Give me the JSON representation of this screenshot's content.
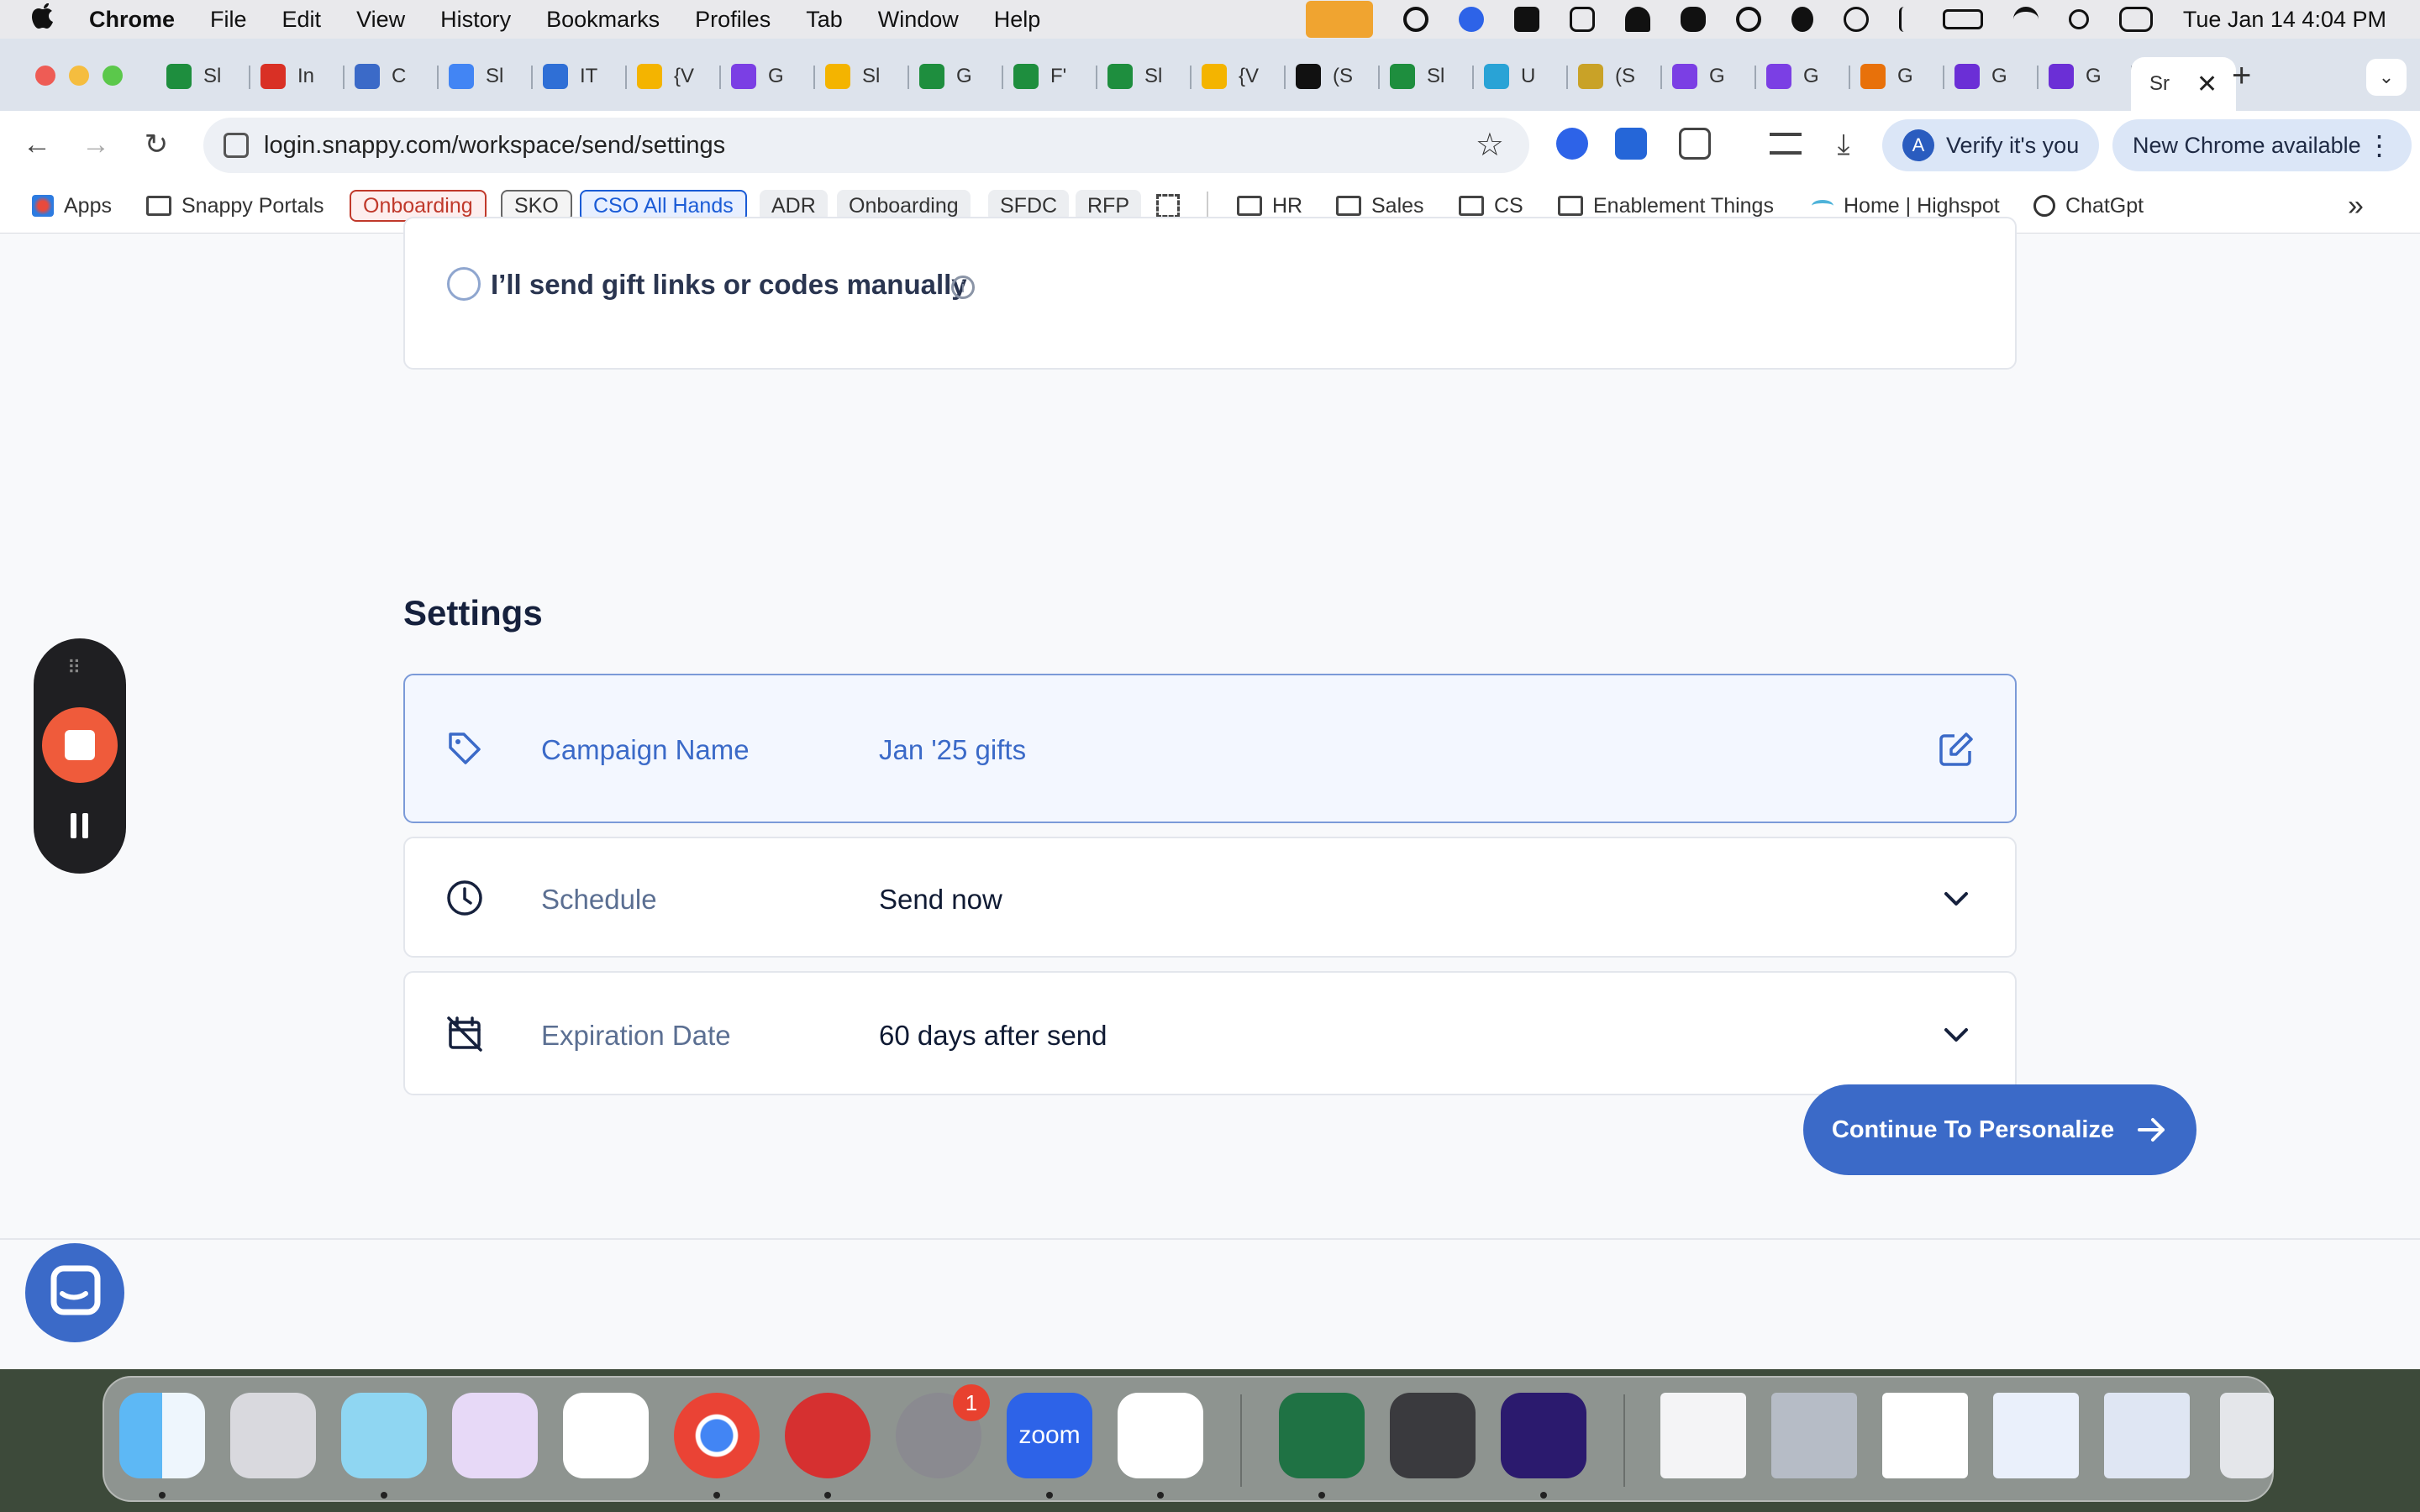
{
  "menubar": {
    "app_name": "Chrome",
    "items": [
      "File",
      "Edit",
      "View",
      "History",
      "Bookmarks",
      "Profiles",
      "Tab",
      "Window",
      "Help"
    ],
    "clock": "Tue Jan 14  4:04 PM"
  },
  "tabs": [
    {
      "label": "Sl",
      "color": "#1e8e3e"
    },
    {
      "label": "In",
      "color": "#d93025"
    },
    {
      "label": "C",
      "color": "#3b6ac8"
    },
    {
      "label": "Sl",
      "color": "#4285f4"
    },
    {
      "label": "IT",
      "color": "#2f6fd6"
    },
    {
      "label": "{V",
      "color": "#f4b400"
    },
    {
      "label": "G",
      "color": "#7b3fe4"
    },
    {
      "label": "Sl",
      "color": "#f4b400"
    },
    {
      "label": "G",
      "color": "#1e8e3e"
    },
    {
      "label": "F'",
      "color": "#1e8e3e"
    },
    {
      "label": "Sl",
      "color": "#1e8e3e"
    },
    {
      "label": "{V",
      "color": "#f4b400"
    },
    {
      "label": "(S",
      "color": "#111111"
    },
    {
      "label": "Sl",
      "color": "#1e8e3e"
    },
    {
      "label": "U",
      "color": "#29a3d6"
    },
    {
      "label": "(S",
      "color": "#c9a227"
    },
    {
      "label": "G",
      "color": "#7b3fe4"
    },
    {
      "label": "G",
      "color": "#7b3fe4"
    },
    {
      "label": "G",
      "color": "#e8710a"
    },
    {
      "label": "G",
      "color": "#6b2fd6"
    },
    {
      "label": "G",
      "color": "#6b2fd6"
    }
  ],
  "active_tab": {
    "label": "Sr"
  },
  "toolbar": {
    "url": "login.snappy.com/workspace/send/settings",
    "verify_label": "Verify it's you",
    "avatar_letter": "A",
    "update_label": "New Chrome available"
  },
  "bookmarks": {
    "apps": "Apps",
    "snappy_portals": "Snappy Portals",
    "tags": [
      "Onboarding",
      "SKO",
      "CSO All Hands",
      "ADR",
      "Onboarding",
      "SFDC",
      "RFP"
    ],
    "folders": [
      "HR",
      "Sales",
      "CS",
      "Enablement Things"
    ],
    "highspot": "Home | Highspot",
    "chatgpt": "ChatGpt",
    "more": "»"
  },
  "page": {
    "manual_option": "I’ll send gift links or codes manually",
    "section_title": "Settings",
    "settings": [
      {
        "label": "Campaign Name",
        "value": "Jan '25 gifts",
        "action": "edit-icon"
      },
      {
        "label": "Schedule",
        "value": "Send now",
        "action": "chevron-down-icon"
      },
      {
        "label": "Expiration Date",
        "value": "60 days after send",
        "action": "chevron-down-icon"
      }
    ],
    "cta_label": "Continue To Personalize"
  },
  "dock": {
    "notification_badge": "1",
    "zoom_label": "zoom"
  },
  "colors": {
    "accent": "#3b6ac8",
    "label_text": "#5b6f92",
    "value_text": "#0f1a33",
    "recorder_stop": "#ef5b3b"
  }
}
